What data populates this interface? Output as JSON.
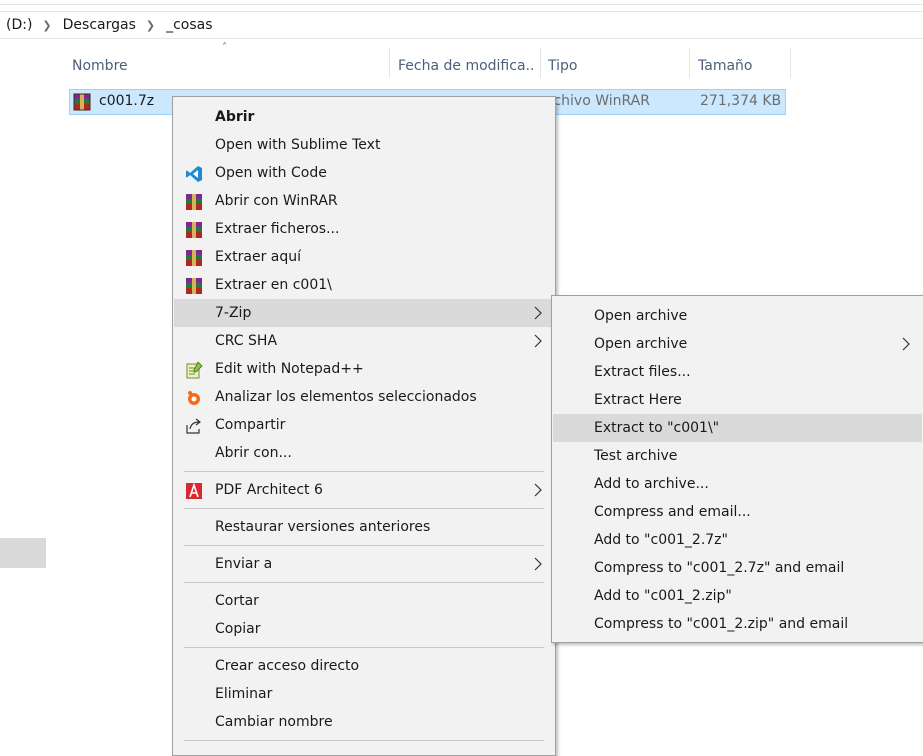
{
  "breadcrumb": {
    "drive": "(D:)",
    "items": [
      "Descargas",
      "_cosas"
    ]
  },
  "columns": {
    "name": "Nombre",
    "date": "Fecha de modifica...",
    "type": "Tipo",
    "size": "Tamaño"
  },
  "file": {
    "name": "c001.7z",
    "type": "rchivo WinRAR",
    "size": "271,374 KB"
  },
  "context_menu": {
    "items": [
      {
        "label": "Abrir",
        "icon": ""
      },
      {
        "label": "Open with Sublime Text",
        "icon": ""
      },
      {
        "label": "Open with Code",
        "icon": "vscode-icon"
      },
      {
        "label": "Abrir con WinRAR",
        "icon": "winrar-icon"
      },
      {
        "label": "Extraer ficheros...",
        "icon": "winrar-icon"
      },
      {
        "label": "Extraer aquí",
        "icon": "winrar-icon"
      },
      {
        "label": "Extraer en c001\\",
        "icon": "winrar-icon"
      },
      {
        "label": "7-Zip",
        "icon": "",
        "submenu": true,
        "highlighted": true
      },
      {
        "label": "CRC SHA",
        "icon": "",
        "submenu": true
      },
      {
        "label": "Edit with Notepad++",
        "icon": "notepadpp-icon"
      },
      {
        "label": "Analizar los elementos seleccionados",
        "icon": "avast-icon"
      },
      {
        "label": "Compartir",
        "icon": "share-icon"
      },
      {
        "label": "Abrir con...",
        "icon": ""
      },
      {
        "label": "PDF Architect 6",
        "icon": "pdf-architect-icon",
        "submenu": true
      },
      {
        "label": "Restaurar versiones anteriores",
        "icon": ""
      },
      {
        "label": "Enviar a",
        "icon": "",
        "submenu": true
      },
      {
        "label": "Cortar",
        "icon": ""
      },
      {
        "label": "Copiar",
        "icon": ""
      },
      {
        "label": "Crear acceso directo",
        "icon": ""
      },
      {
        "label": "Eliminar",
        "icon": ""
      },
      {
        "label": "Cambiar nombre",
        "icon": ""
      }
    ]
  },
  "submenu_7zip": {
    "items": [
      {
        "label": "Open archive"
      },
      {
        "label": "Open archive",
        "submenu": true
      },
      {
        "label": "Extract files..."
      },
      {
        "label": "Extract Here"
      },
      {
        "label": "Extract to \"c001\\\"",
        "highlighted": true
      },
      {
        "label": "Test archive"
      },
      {
        "label": "Add to archive..."
      },
      {
        "label": "Compress and email..."
      },
      {
        "label": "Add to \"c001_2.7z\""
      },
      {
        "label": "Compress to \"c001_2.7z\" and email"
      },
      {
        "label": "Add to \"c001_2.zip\""
      },
      {
        "label": "Compress to \"c001_2.zip\" and email"
      }
    ]
  },
  "colors": {
    "selection_bg": "#cce8ff",
    "selection_border": "#99d1ff",
    "menu_bg": "#f2f2f2",
    "menu_highlight": "#dadada",
    "header_text": "#4c607a"
  }
}
